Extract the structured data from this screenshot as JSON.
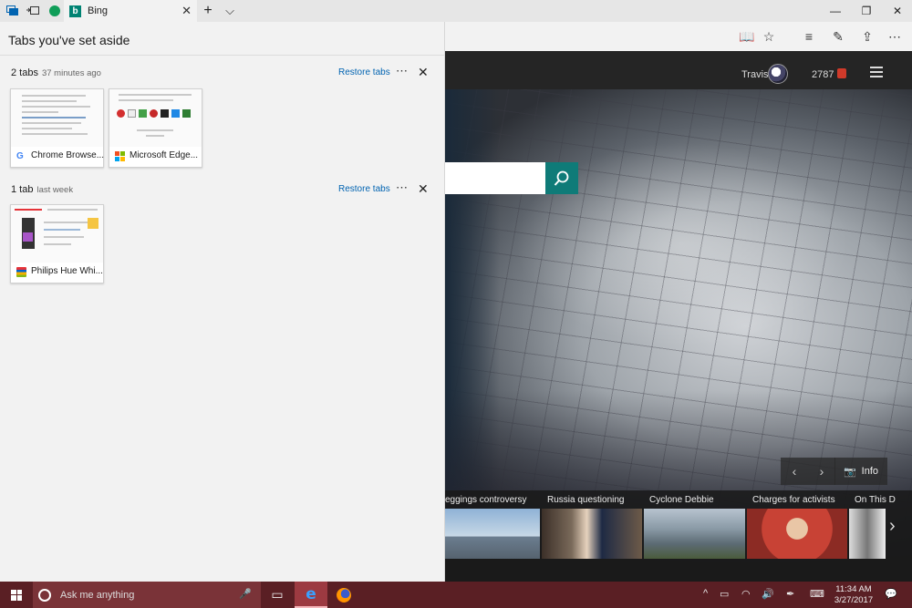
{
  "titlebar": {
    "tab_title": "Bing",
    "new_tab_symbol": "+",
    "tab_list_symbol": "⌵"
  },
  "panel": {
    "title": "Tabs you've set aside",
    "groups": [
      {
        "count_label": "2 tabs",
        "time_label": "37 minutes ago",
        "restore_label": "Restore tabs",
        "tabs": [
          {
            "label": "Chrome Browse...",
            "icon": "google-icon"
          },
          {
            "label": "Microsoft Edge...",
            "icon": "microsoft-icon"
          }
        ]
      },
      {
        "count_label": "1 tab",
        "time_label": "last week",
        "restore_label": "Restore tabs",
        "tabs": [
          {
            "label": "Philips Hue Whi...",
            "icon": "ebay-bag-icon"
          }
        ]
      }
    ]
  },
  "bing": {
    "user_name": "Travis",
    "points": "2787",
    "info_label": "Info",
    "news": [
      {
        "title": "eggings controversy"
      },
      {
        "title": "Russia questioning"
      },
      {
        "title": "Cyclone Debbie"
      },
      {
        "title": "Charges for activists"
      },
      {
        "title": "On This D"
      }
    ]
  },
  "taskbar": {
    "search_placeholder": "Ask me anything",
    "time": "11:34 AM",
    "date": "3/27/2017"
  },
  "colors": {
    "accent_link": "#0063b1",
    "bing_teal": "#0f7b78",
    "taskbar": "#5a1f24"
  }
}
